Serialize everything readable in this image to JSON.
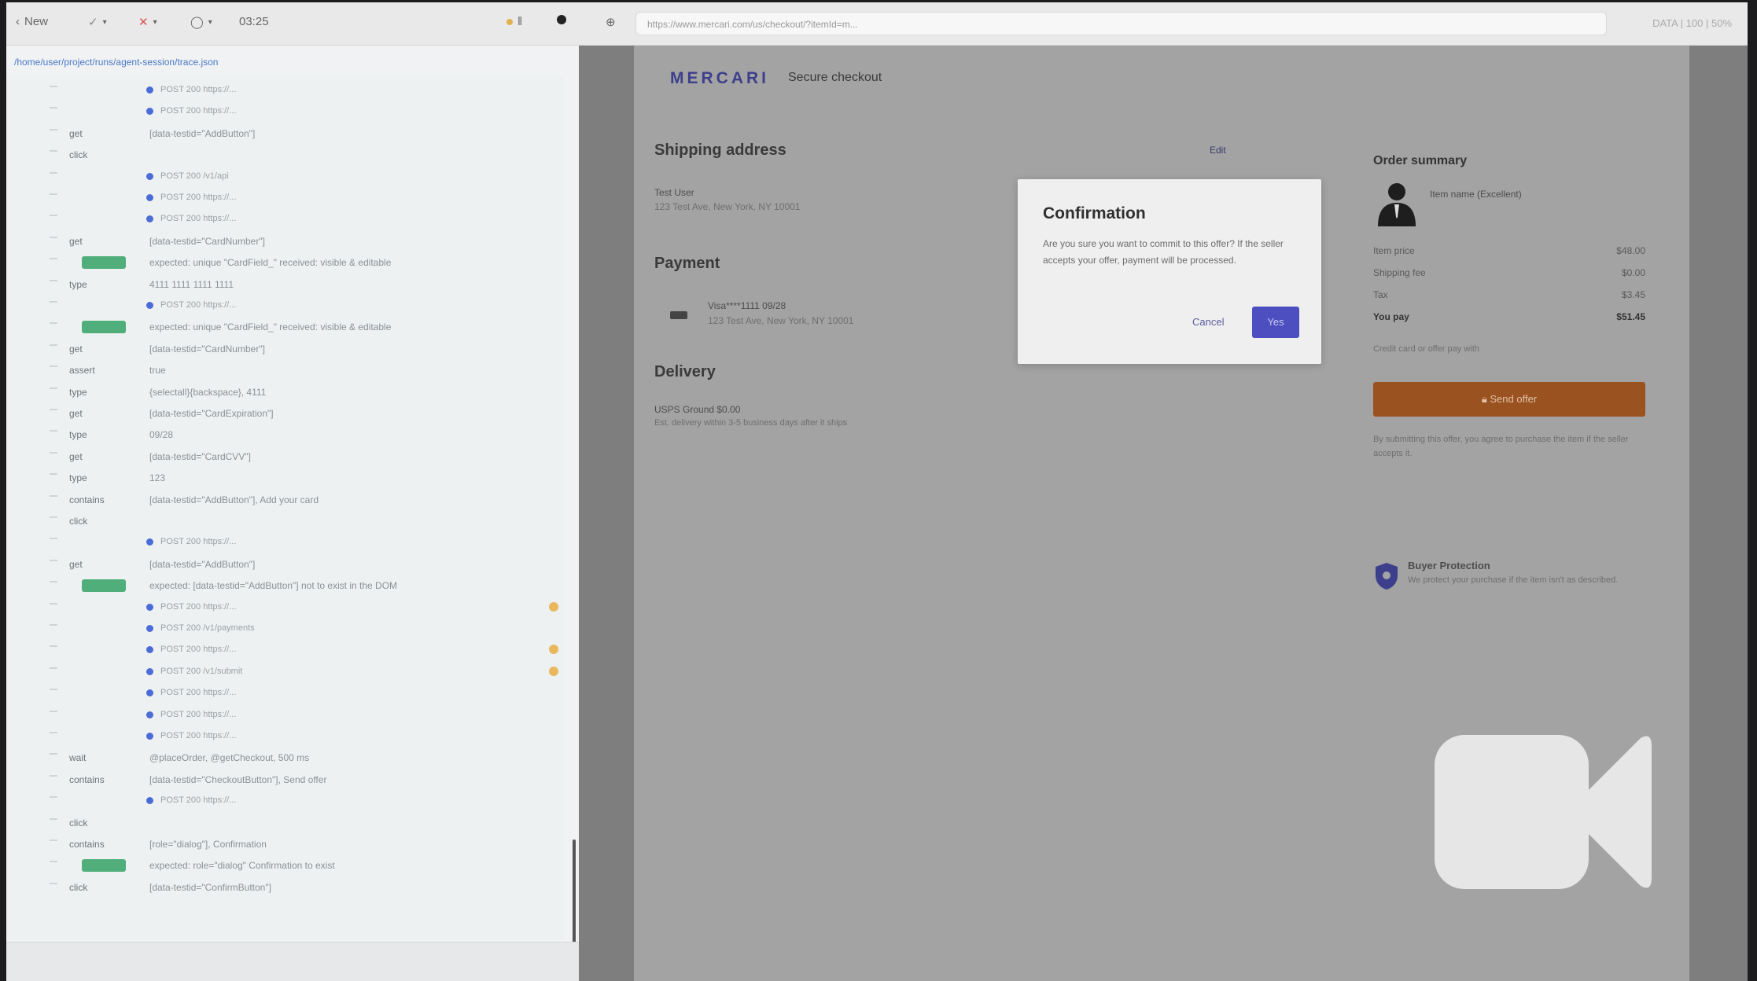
{
  "toolbar": {
    "back_label": "New",
    "timer": "03:25",
    "url": "https://www.mercari.com/us/checkout/?itemId=m...",
    "right_status": "DATA | 100 | 50%"
  },
  "left_panel": {
    "path": "/home/user/project/runs/agent-session/trace.json",
    "rows": [
      {
        "type": "txt",
        "label": "",
        "text": "POST 200 https://...",
        "dot": true
      },
      {
        "type": "txt",
        "label": "",
        "text": "POST 200 https://...",
        "dot": true
      },
      {
        "type": "txt",
        "label": "get",
        "text": "[data-testid=\"AddButton\"]",
        "dot": false
      },
      {
        "type": "txt",
        "label": "click",
        "text": "",
        "dot": false
      },
      {
        "type": "txt",
        "label": "",
        "text": "POST 200 /v1/api",
        "dot": true
      },
      {
        "type": "txt",
        "label": "",
        "text": "POST 200 https://...",
        "dot": true
      },
      {
        "type": "txt",
        "label": "",
        "text": "POST 200 https://...",
        "dot": true
      },
      {
        "type": "txt",
        "label": "get",
        "text": "[data-testid=\"CardNumber\"]",
        "dot": false
      },
      {
        "type": "tag",
        "label": "",
        "text": "expected: unique \"CardField_\" received: visible & editable",
        "dot": false
      },
      {
        "type": "txt",
        "label": "type",
        "text": "4111 1111 1111 1111",
        "dot": false
      },
      {
        "type": "txt",
        "label": "",
        "text": "POST 200 https://...",
        "dot": true
      },
      {
        "type": "tag",
        "label": "",
        "text": "expected: unique \"CardField_\" received: visible & editable",
        "dot": false
      },
      {
        "type": "txt",
        "label": "get",
        "text": "[data-testid=\"CardNumber\"]",
        "dot": false
      },
      {
        "type": "txt",
        "label": "assert",
        "text": "true",
        "dot": false
      },
      {
        "type": "txt",
        "label": "type",
        "text": "{selectall}{backspace}, 4111",
        "dot": false
      },
      {
        "type": "txt",
        "label": "get",
        "text": "[data-testid=\"CardExpiration\"]",
        "dot": false
      },
      {
        "type": "txt",
        "label": "type",
        "text": "09/28",
        "dot": false
      },
      {
        "type": "txt",
        "label": "get",
        "text": "[data-testid=\"CardCVV\"]",
        "dot": false
      },
      {
        "type": "txt",
        "label": "type",
        "text": "123",
        "dot": false
      },
      {
        "type": "txt",
        "label": "contains",
        "text": "[data-testid=\"AddButton\"], Add your card",
        "dot": false
      },
      {
        "type": "txt",
        "label": "click",
        "text": "",
        "dot": false
      },
      {
        "type": "txt",
        "label": "",
        "text": "POST 200 https://...",
        "dot": true
      },
      {
        "type": "txt",
        "label": "get",
        "text": "[data-testid=\"AddButton\"]",
        "dot": false
      },
      {
        "type": "tag",
        "label": "",
        "text": "expected: [data-testid=\"AddButton\"] not to exist in the DOM",
        "dot": false
      },
      {
        "type": "txt",
        "label": "",
        "text": "POST 200 https://...",
        "dot": true,
        "warn": true
      },
      {
        "type": "txt",
        "label": "",
        "text": "POST 200 /v1/payments",
        "dot": true
      },
      {
        "type": "txt",
        "label": "",
        "text": "POST 200 https://...",
        "dot": true,
        "warn": true
      },
      {
        "type": "txt",
        "label": "",
        "text": "POST 200 /v1/submit",
        "dot": true,
        "warn": true
      },
      {
        "type": "txt",
        "label": "",
        "text": "POST 200 https://...",
        "dot": true
      },
      {
        "type": "txt",
        "label": "",
        "text": "POST 200 https://...",
        "dot": true
      },
      {
        "type": "txt",
        "label": "",
        "text": "POST 200 https://...",
        "dot": true
      },
      {
        "type": "txt",
        "label": "wait",
        "text": "@placeOrder, @getCheckout, 500 ms",
        "dot": false
      },
      {
        "type": "txt",
        "label": "contains",
        "text": "[data-testid=\"CheckoutButton\"], Send offer",
        "dot": false
      },
      {
        "type": "txt",
        "label": "",
        "text": "POST 200 https://...",
        "dot": true
      },
      {
        "type": "txt",
        "label": "click",
        "text": "",
        "dot": false
      },
      {
        "type": "txt",
        "label": "contains",
        "text": "[role=\"dialog\"], Confirmation",
        "dot": false
      },
      {
        "type": "tag",
        "label": "",
        "text": "expected: role=\"dialog\" Confirmation to exist",
        "dot": false
      },
      {
        "type": "txt",
        "label": "click",
        "text": "[data-testid=\"ConfirmButton\"]",
        "dot": false
      }
    ]
  },
  "page": {
    "logo": "MERCARI",
    "secure_checkout": "Secure checkout",
    "shipping_title": "Shipping address",
    "edit_label": "Edit",
    "shipping_name": "Test User",
    "shipping_address": "123 Test Ave, New York, NY 10001",
    "payment_title": "Payment",
    "card_label": "Visa****1111 09/28",
    "card_address": "123 Test Ave, New York, NY 10001",
    "delivery_title": "Delivery",
    "delivery_method": "USPS Ground $0.00",
    "delivery_note": "Est. delivery within 3-5 business days after it ships",
    "summary_title": "Order summary",
    "item_name": "Item name (Excellent)",
    "summary_lines": [
      {
        "label": "Item price",
        "value": "$48.00"
      },
      {
        "label": "Shipping fee",
        "value": "$0.00"
      },
      {
        "label": "Tax",
        "value": "$3.45"
      },
      {
        "label": "You pay",
        "value": "$51.45"
      }
    ],
    "pay_note": "Credit card or offer pay with",
    "buy_label": "Send offer",
    "legal_text": "By submitting this offer, you agree to purchase the item if the seller accepts it.",
    "protection_title": "Buyer Protection",
    "protection_text": "We protect your purchase if the item isn't as described."
  },
  "modal": {
    "title": "Confirmation",
    "body": "Are you sure you want to commit to this offer? If the seller accepts your offer, payment will be processed.",
    "cancel_label": "Cancel",
    "yes_label": "Yes"
  },
  "colors": {
    "brand": "#3d3f8c",
    "buy_button": "#9a5220",
    "yes_button": "#4d4fc0",
    "success_tag": "#4fae7a"
  },
  "icons": {
    "camera": "video-camera-icon",
    "shield": "shield-icon",
    "avatar": "user-avatar-icon"
  }
}
